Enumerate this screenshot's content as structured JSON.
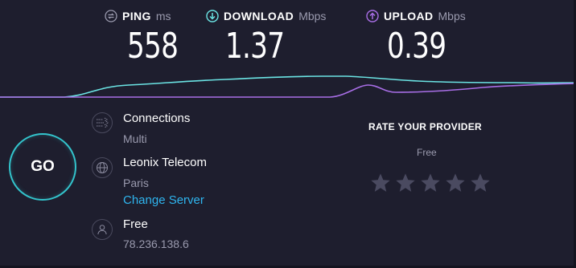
{
  "metrics": {
    "ping": {
      "label": "PING",
      "unit": "ms",
      "value": "558",
      "icon": "ping-icon"
    },
    "download": {
      "label": "DOWNLOAD",
      "unit": "Mbps",
      "value": "1.37",
      "icon": "download-arrow-icon"
    },
    "upload": {
      "label": "UPLOAD",
      "unit": "Mbps",
      "value": "0.39",
      "icon": "upload-arrow-icon"
    }
  },
  "colors": {
    "background": "#1e1e2e",
    "download_accent": "#6be4e4",
    "upload_accent": "#a86ee6",
    "link": "#2fb5ef",
    "go_ring": "#33c4cc",
    "star": "#4a4a60"
  },
  "go_button": {
    "label": "GO"
  },
  "connections": {
    "title": "Connections",
    "value": "Multi",
    "icon": "connections-icon"
  },
  "server": {
    "title": "Leonix Telecom",
    "location": "Paris",
    "change_label": "Change Server",
    "icon": "globe-icon"
  },
  "user": {
    "title": "Free",
    "ip": "78.236.138.6",
    "icon": "user-icon"
  },
  "rate": {
    "title": "RATE YOUR PROVIDER",
    "provider": "Free",
    "stars_total": 5,
    "stars_selected": 0
  }
}
